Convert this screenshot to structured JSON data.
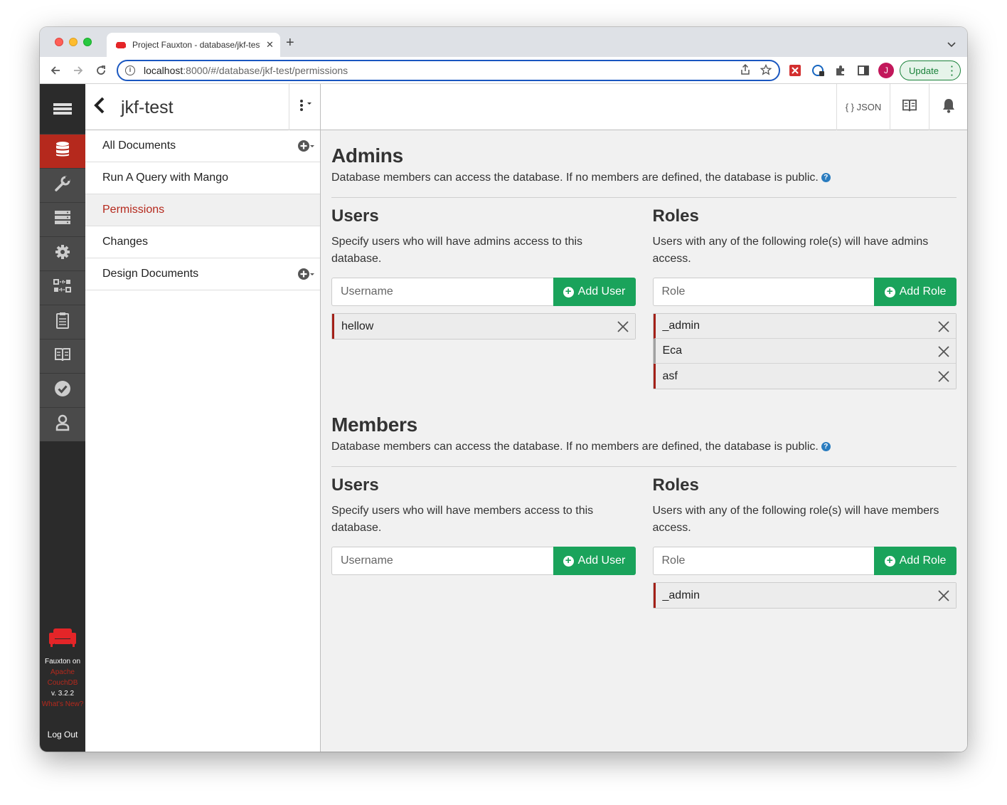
{
  "browser": {
    "tab_title": "Project Fauxton - database/jkf-test/permissions",
    "url_host": "localhost",
    "url_rest": ":8000/#/database/jkf-test/permissions",
    "avatar_letter": "J",
    "update_label": "Update"
  },
  "header": {
    "db_name": "jkf-test",
    "json_label": "{ } JSON"
  },
  "sidebar": {
    "items": [
      {
        "label": "All Documents",
        "has_add": true,
        "active": false
      },
      {
        "label": "Run A Query with Mango",
        "has_add": false,
        "active": false
      },
      {
        "label": "Permissions",
        "has_add": false,
        "active": true
      },
      {
        "label": "Changes",
        "has_add": false,
        "active": false
      },
      {
        "label": "Design Documents",
        "has_add": true,
        "active": false
      }
    ]
  },
  "leftnav": {
    "icons": [
      "database-icon",
      "wrench-icon",
      "server-icon",
      "gear-icon",
      "replication-icon",
      "clipboard-icon",
      "book-icon",
      "check-circle-icon",
      "user-icon"
    ],
    "footer_app": "Fauxton on",
    "footer_link1": "Apache",
    "footer_link2": "CouchDB",
    "footer_version": "v. 3.2.2",
    "footer_whats_new": "What's New?",
    "logout": "Log Out"
  },
  "admins": {
    "title": "Admins",
    "description": "Database members can access the database. If no members are defined, the database is public.",
    "users": {
      "title": "Users",
      "description": "Specify users who will have admins access to this database.",
      "placeholder": "Username",
      "button": "Add User",
      "entries": [
        "hellow"
      ]
    },
    "roles": {
      "title": "Roles",
      "description": "Users with any of the following role(s) will have admins access.",
      "placeholder": "Role",
      "button": "Add Role",
      "entries": [
        "_admin",
        "Eca",
        "asf"
      ]
    }
  },
  "members": {
    "title": "Members",
    "description": "Database members can access the database. If no members are defined, the database is public.",
    "users": {
      "title": "Users",
      "description": "Specify users who will have members access to this database.",
      "placeholder": "Username",
      "button": "Add User",
      "entries": []
    },
    "roles": {
      "title": "Roles",
      "description": "Users with any of the following role(s) will have members access.",
      "placeholder": "Role",
      "button": "Add Role",
      "entries": [
        "_admin"
      ]
    }
  },
  "colors": {
    "accent_red": "#b5291d",
    "add_green": "#1aa35b",
    "nav_dark": "#2b2b2b"
  }
}
